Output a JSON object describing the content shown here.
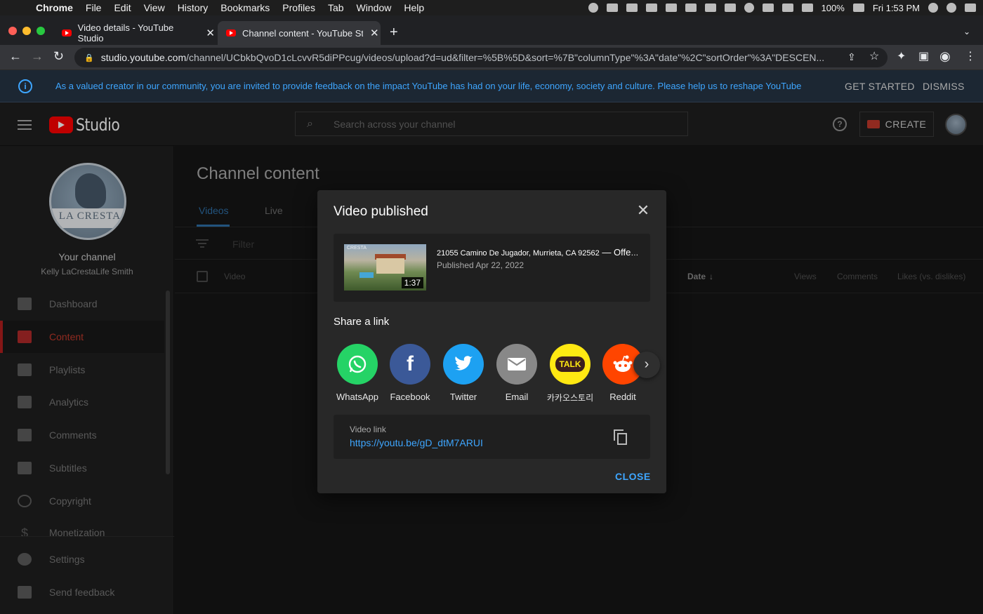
{
  "menubar": {
    "app": "Chrome",
    "items": [
      "File",
      "Edit",
      "View",
      "History",
      "Bookmarks",
      "Profiles",
      "Tab",
      "Window",
      "Help"
    ],
    "battery": "100%",
    "clock": "Fri 1:53 PM"
  },
  "tabs": [
    {
      "title": "Video details - YouTube Studio",
      "active": false
    },
    {
      "title": "Channel content - YouTube Stu",
      "active": true
    }
  ],
  "address": {
    "host": "studio.youtube.com",
    "path": "/channel/UCbkbQvoD1cLcvvR5diPPcug/videos/upload?d=ud&filter=%5B%5D&sort=%7B\"columnType\"%3A\"date\"%2C\"sortOrder\"%3A\"DESCEN..."
  },
  "banner": {
    "message": "As a valued creator in our community, you are invited to provide feedback on the impact YouTube has had on your life, economy, society and culture. Please help us to reshape YouTube",
    "get_started": "GET STARTED",
    "dismiss": "DISMISS"
  },
  "header": {
    "logo_text": "Studio",
    "search_placeholder": "Search across your channel",
    "create_label": "CREATE"
  },
  "sidebar": {
    "channel_logo_text": "LA CRESTA",
    "channel_label": "Your channel",
    "channel_name": "Kelly LaCrestaLife Smith",
    "items": [
      {
        "label": "Dashboard",
        "icon": "dashboard-icon",
        "active": false
      },
      {
        "label": "Content",
        "icon": "content-icon",
        "active": true
      },
      {
        "label": "Playlists",
        "icon": "playlists-icon",
        "active": false
      },
      {
        "label": "Analytics",
        "icon": "analytics-icon",
        "active": false
      },
      {
        "label": "Comments",
        "icon": "comments-icon",
        "active": false
      },
      {
        "label": "Subtitles",
        "icon": "subtitles-icon",
        "active": false
      },
      {
        "label": "Copyright",
        "icon": "copyright-icon",
        "active": false
      },
      {
        "label": "Monetization",
        "icon": "dollar-icon",
        "active": false
      }
    ],
    "bottom_items": [
      {
        "label": "Settings",
        "icon": "gear-icon"
      },
      {
        "label": "Send feedback",
        "icon": "feedback-icon"
      }
    ]
  },
  "main": {
    "title": "Channel content",
    "tabs": [
      "Videos",
      "Live"
    ],
    "filter_placeholder": "Filter",
    "columns": {
      "video": "Video",
      "date": "Date",
      "views": "Views",
      "comments": "Comments",
      "likes": "Likes (vs. dislikes)"
    }
  },
  "modal": {
    "title": "Video published",
    "video_title": "21055 Camino De Jugador, Murrieta, CA 92562",
    "video_title_tail": " — Offered ...",
    "published": "Published Apr 22, 2022",
    "duration": "1:37",
    "thumb_watermark": "CRESTA",
    "share_heading": "Share a link",
    "share_targets": [
      {
        "label": "WhatsApp",
        "color": "#25d366"
      },
      {
        "label": "Facebook",
        "color": "#3b5998"
      },
      {
        "label": "Twitter",
        "color": "#1da1f2"
      },
      {
        "label": "Email",
        "color": "#888888"
      },
      {
        "label": "카카오스토리",
        "color": "#ffe812",
        "glyph": "TALK"
      },
      {
        "label": "Reddit",
        "color": "#ff4500"
      }
    ],
    "link_label": "Video link",
    "link_url": "https://youtu.be/gD_dtM7ARUI",
    "close_label": "CLOSE"
  }
}
